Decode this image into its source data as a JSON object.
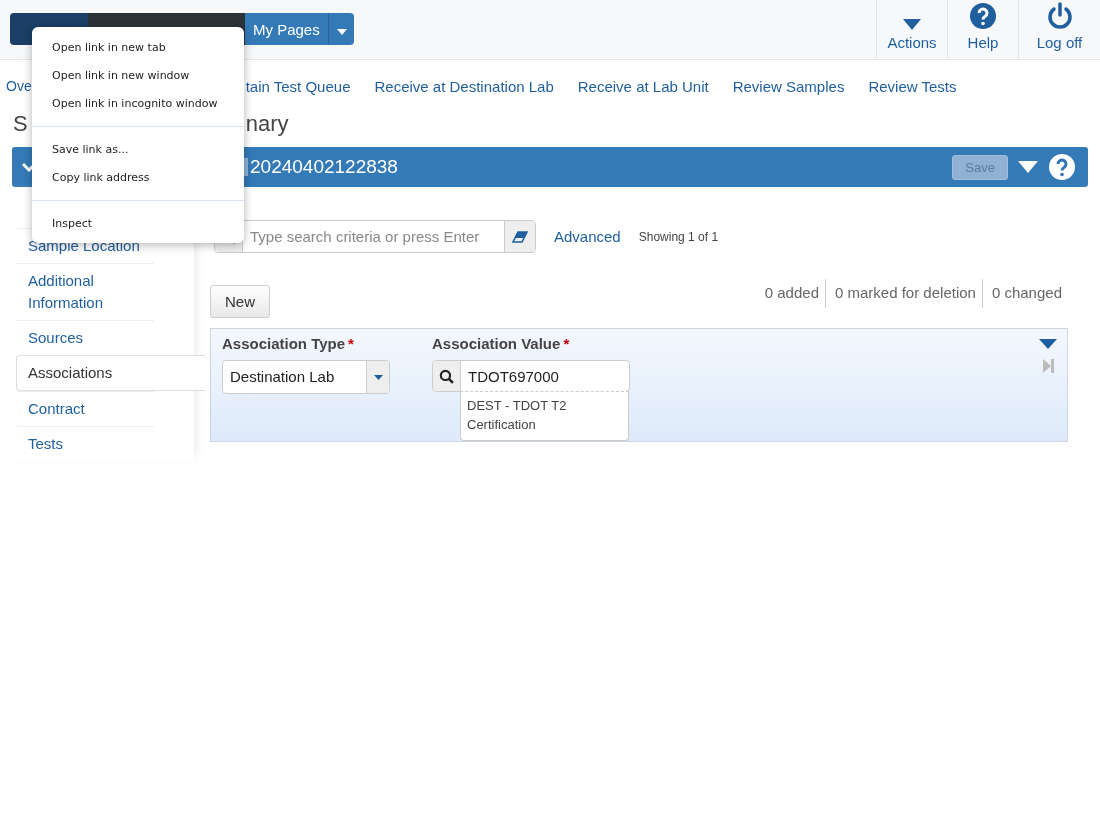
{
  "top_bar": {
    "buttons": [
      {
        "kind": "dark"
      },
      {
        "kind": "dark"
      },
      {
        "label": "My Pages",
        "kind": "menu"
      }
    ],
    "actions": [
      {
        "label": "Actions",
        "kind": "caret"
      },
      {
        "label": "Help",
        "kind": "help"
      },
      {
        "label": "Log off",
        "kind": "power"
      }
    ]
  },
  "nav_links": [
    "Ove",
    "tain Test Queue",
    "Receive at Destination Lab",
    "Receive at Lab Unit",
    "Review Samples",
    "Review Tests"
  ],
  "page_title": [
    "S",
    "nary"
  ],
  "record_bar": {
    "title": "20240402122838",
    "save_label": "Save",
    "save_disabled": true
  },
  "sidebar": {
    "items": [
      {
        "label": "Sample Location",
        "selected": false
      },
      {
        "label": "Additional Information",
        "selected": false
      },
      {
        "label": "Sources",
        "selected": false
      },
      {
        "label": "Associations",
        "selected": true
      },
      {
        "label": "Contract",
        "selected": false
      },
      {
        "label": "Tests",
        "selected": false
      }
    ]
  },
  "search": {
    "placeholder": "Type search criteria or press Enter",
    "advanced": "Advanced",
    "showing": "Showing 1 of 1"
  },
  "new_button": "New",
  "counts": [
    "0 added",
    "0 marked for deletion",
    "0 changed"
  ],
  "association": {
    "type_label": "Association Type",
    "required_mark": "*",
    "type_value": "Destination Lab",
    "value_label": "Association Value",
    "value": "TDOT697000",
    "suggestion": "DEST - TDOT T2 Certification"
  },
  "context_menu": {
    "groups": [
      [
        "Open link in new tab",
        "Open link in new window",
        "Open link in incognito window"
      ],
      [
        "Save link as...",
        "Copy link address"
      ],
      [
        "Inspect"
      ]
    ]
  }
}
